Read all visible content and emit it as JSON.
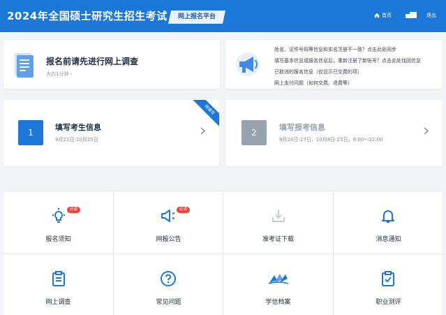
{
  "header": {
    "title": "2024年全国硕士研究生招生考试",
    "platform_tag": "网上报名平台",
    "nav_home": "首页",
    "nav_logout": "退出"
  },
  "survey": {
    "title": "报名前请先进行网上调查",
    "duration": "大约1分钟",
    "doc_icon": "document-icon"
  },
  "notices": {
    "megaphone_icon": "megaphone-icon",
    "lines": [
      "姓名、证件号码等信息和实名注册不一致？点击此处同步",
      "填写基本信息或报名信息后，重新注册了新账号？点击此处找回信息",
      "已取消的报名信息（仅显示已交费的项）",
      "网上支付问题（如何交费、退费等）"
    ]
  },
  "steps": [
    {
      "num": "1",
      "title": "填写考生信息",
      "date": "9月21日-10月25日",
      "ribbon": "待填写"
    },
    {
      "num": "2",
      "title": "填写报考信息",
      "date": "9月24日-27日，10月8日-25日，9:00～22:00"
    }
  ],
  "menu": [
    {
      "label": "报名须知",
      "icon": "lightbulb-icon",
      "badge": "必读"
    },
    {
      "label": "网报公告",
      "icon": "announcement-icon",
      "badge": "必读"
    },
    {
      "label": "准考证下载",
      "icon": "download-icon"
    },
    {
      "label": "消息通知",
      "icon": "bell-icon"
    },
    {
      "label": "网上调查",
      "icon": "clipboard-icon"
    },
    {
      "label": "常见问题",
      "icon": "question-icon"
    },
    {
      "label": "学信档案",
      "icon": "xuexin-logo-icon"
    },
    {
      "label": "职业测评",
      "icon": "clipboard-check-icon"
    }
  ],
  "colors": {
    "primary": "#1b78d9",
    "badge": "#e8453c",
    "disabled": "#98a2ae"
  }
}
